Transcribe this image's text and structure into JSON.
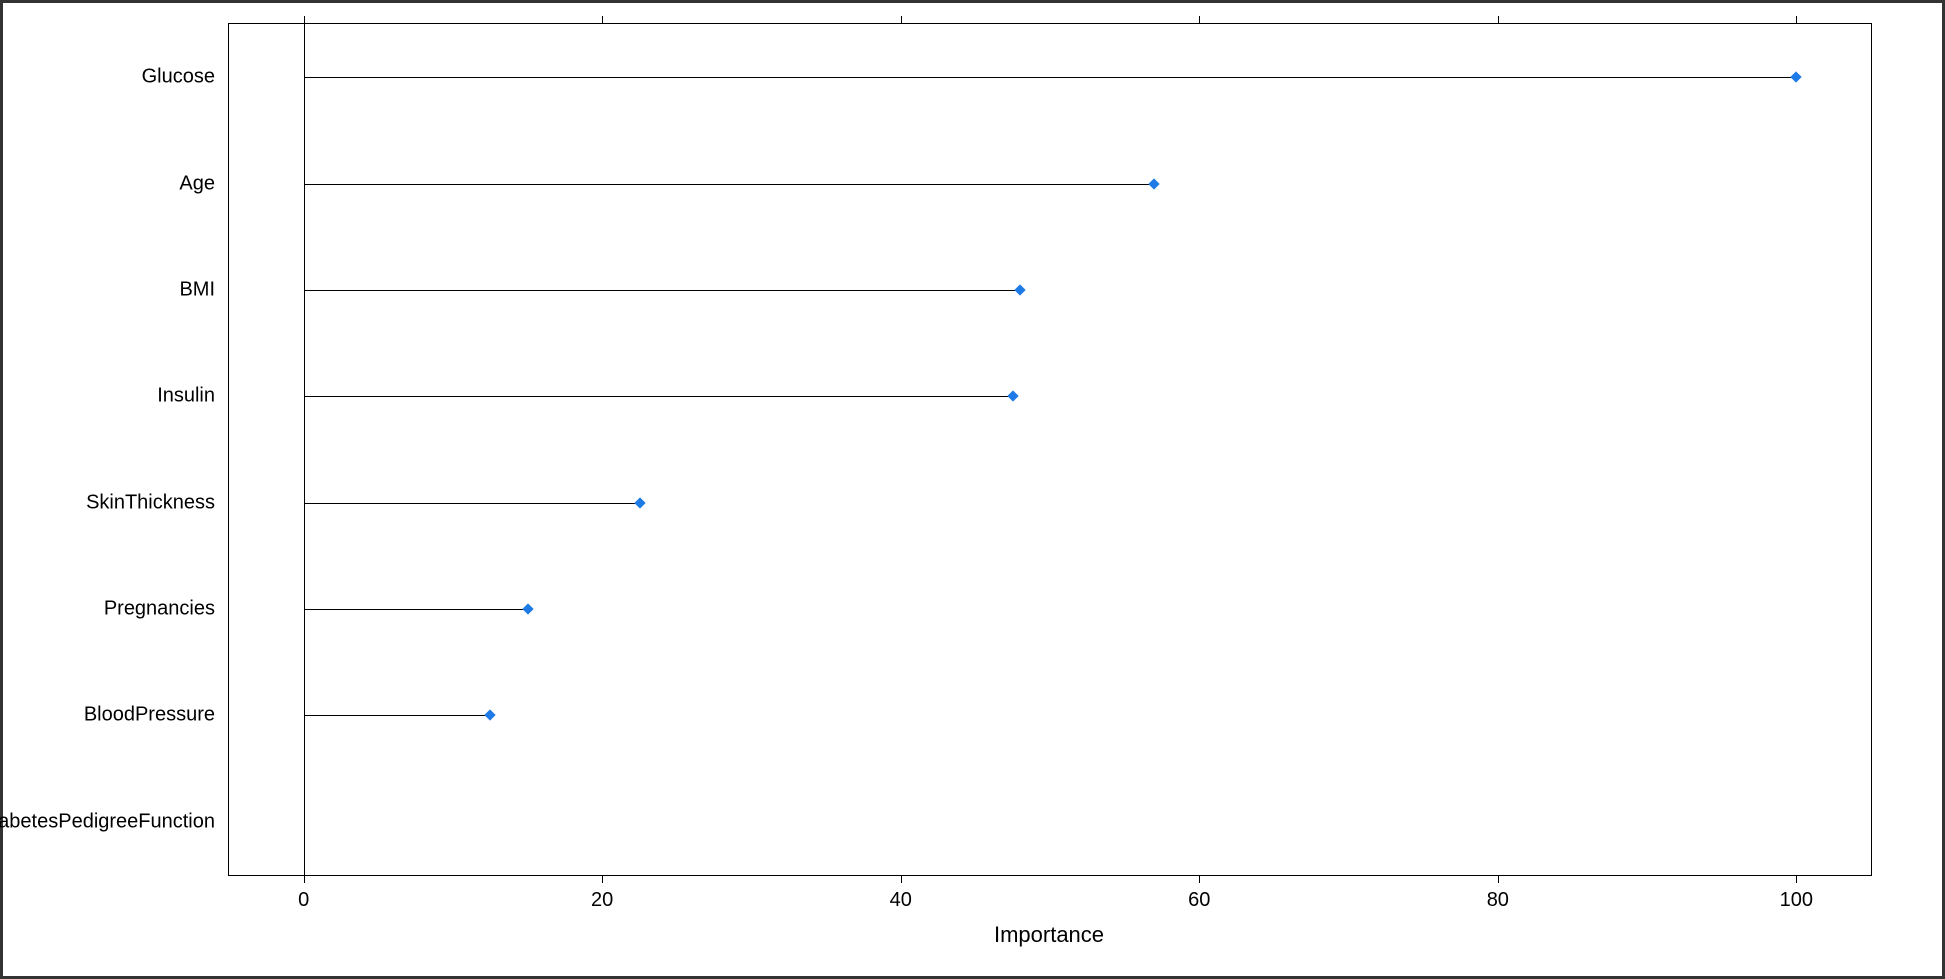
{
  "chart_data": {
    "type": "bar",
    "orientation": "horizontal",
    "style": "lollipop",
    "categories": [
      "Glucose",
      "Age",
      "BMI",
      "Insulin",
      "SkinThickness",
      "Pregnancies",
      "BloodPressure",
      "DiabetesPedigreeFunction"
    ],
    "values": [
      100,
      57,
      48,
      47.5,
      22.5,
      15,
      12.5,
      0
    ],
    "xlabel": "Importance",
    "ylabel": "",
    "title": "",
    "xlim": [
      -5,
      105
    ],
    "xticks": [
      0,
      20,
      40,
      60,
      80,
      100
    ],
    "ytick_marks": false,
    "dot_color": "#1e7ae6"
  }
}
